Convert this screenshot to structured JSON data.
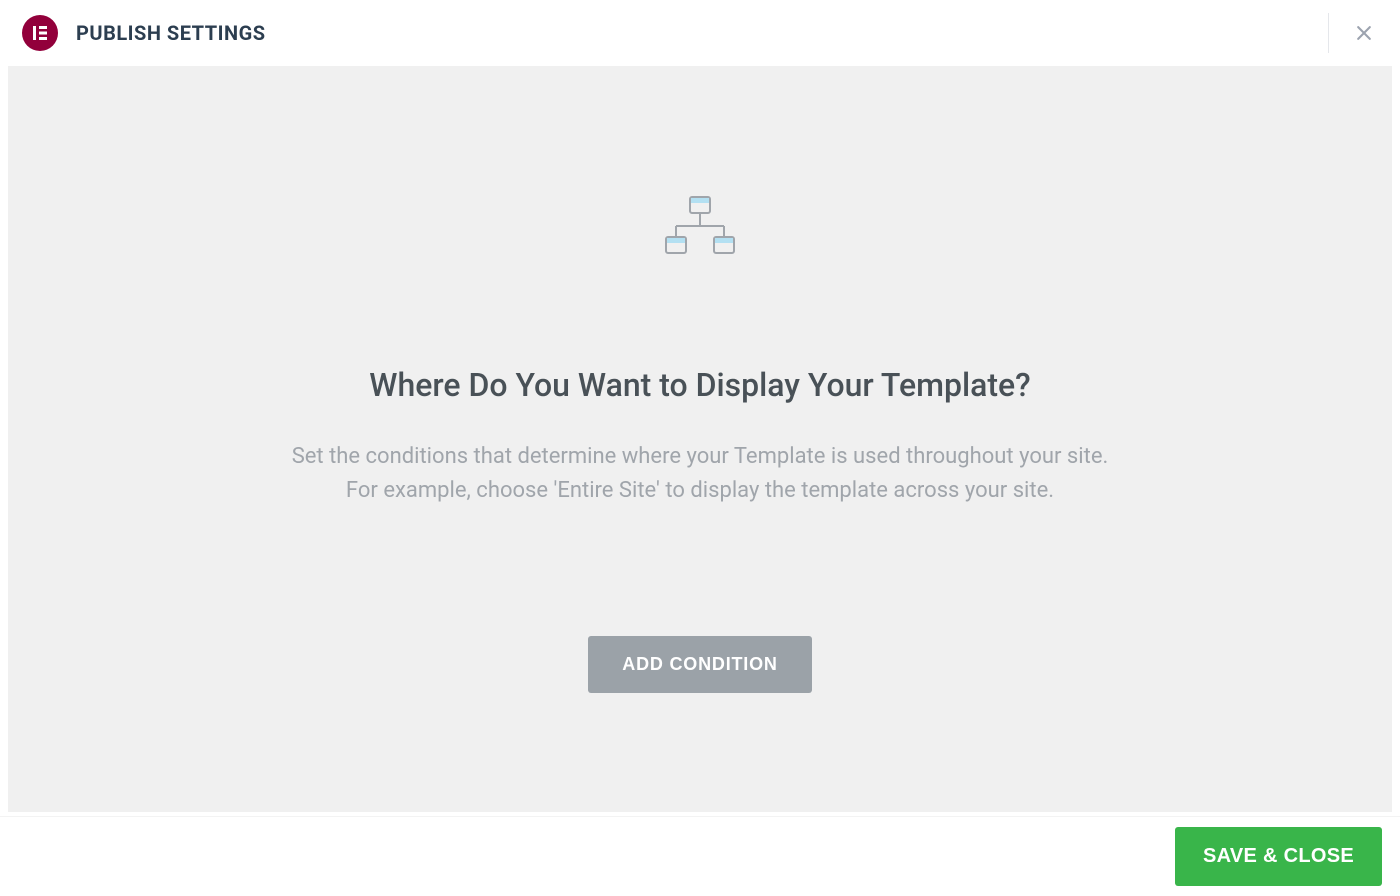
{
  "header": {
    "title": "PUBLISH SETTINGS"
  },
  "main": {
    "heading": "Where Do You Want to Display Your Template?",
    "description_line1": "Set the conditions that determine where your Template is used throughout your site.",
    "description_line2": "For example, choose 'Entire Site' to display the template across your site.",
    "add_condition_label": "ADD CONDITION"
  },
  "footer": {
    "save_close_label": "SAVE & CLOSE"
  }
}
